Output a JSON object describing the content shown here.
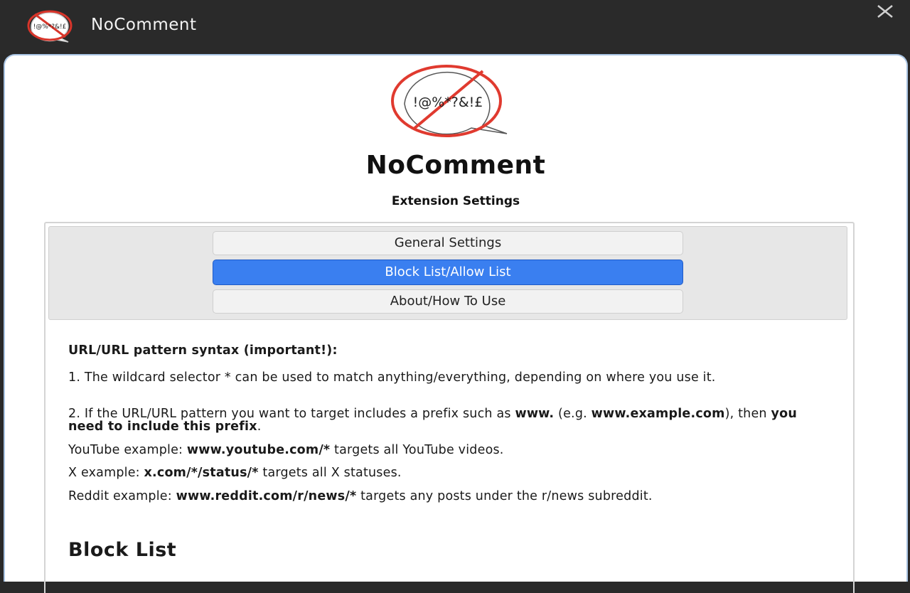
{
  "window": {
    "app_name": "NoComment",
    "close_icon": "close-icon",
    "logo_icon": "no-swearing-speech-bubble-icon",
    "logo_text": "!@%*?&!£"
  },
  "header": {
    "title": "NoComment",
    "subtitle": "Extension Settings"
  },
  "tabs": [
    {
      "label": "General Settings",
      "active": false
    },
    {
      "label": "Block List/Allow List",
      "active": true
    },
    {
      "label": "About/How To Use",
      "active": false
    }
  ],
  "colors": {
    "accent": "#3a7ff0",
    "logo_red": "#e03a2f",
    "topbar": "#2a2a2a"
  },
  "content": {
    "syntax_heading": "URL/URL pattern syntax (important!):",
    "rule1": "1. The wildcard selector * can be used to match anything/everything, depending on where you use it.",
    "rule2": {
      "part1": "2. If the URL/URL pattern you want to target includes a prefix such as ",
      "prefix": "www.",
      "part2": " (e.g. ",
      "example": "www.example.com",
      "part3": "), then ",
      "emphasis": "you need to include this prefix",
      "part4": "."
    },
    "examples": [
      {
        "label": "YouTube example: ",
        "pattern": "www.youtube.com/*",
        "description": " targets all YouTube videos."
      },
      {
        "label": "X example: ",
        "pattern": "x.com/*/status/*",
        "description": " targets all X statuses."
      },
      {
        "label": "Reddit example: ",
        "pattern": "www.reddit.com/r/news/*",
        "description": " targets any posts under the r/news subreddit."
      }
    ],
    "block_list_heading": "Block List"
  }
}
